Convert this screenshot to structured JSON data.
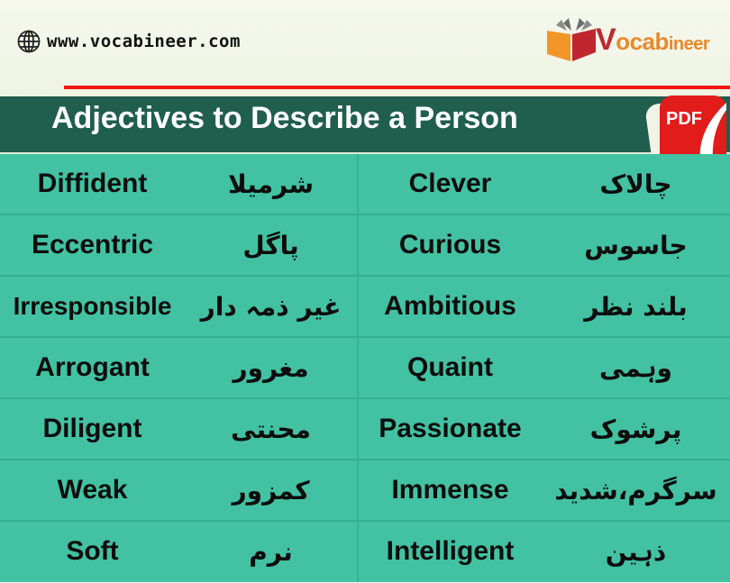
{
  "header": {
    "website": "www.vocabineer.com",
    "globe_icon": "globe-icon",
    "logo": {
      "initial": "V",
      "rest_a": "ocab",
      "rest_b": "ineer",
      "book_icon": "open-book-icon"
    },
    "accent_red": "#f21414"
  },
  "title": "Adjectives to Describe a Person",
  "pdf_badge": {
    "label": "PDF",
    "icon": "pdf-icon"
  },
  "colors": {
    "title_bg": "#205e4d",
    "table_bg": "#42c2a2"
  },
  "rows": [
    {
      "left_en": "Diffident",
      "left_ur": "شرمیلا",
      "right_en": "Clever",
      "right_ur": "چالاک"
    },
    {
      "left_en": "Eccentric",
      "left_ur": "پاگل",
      "right_en": "Curious",
      "right_ur": "جاسوس"
    },
    {
      "left_en": "Irresponsible",
      "left_ur": "غیر ذمہ دار",
      "right_en": "Ambitious",
      "right_ur": "بلند نظر"
    },
    {
      "left_en": "Arrogant",
      "left_ur": "مغرور",
      "right_en": "Quaint",
      "right_ur": "وہمی"
    },
    {
      "left_en": "Diligent",
      "left_ur": "محنتی",
      "right_en": "Passionate",
      "right_ur": "پرشوک"
    },
    {
      "left_en": "Weak",
      "left_ur": "کمزور",
      "right_en": "Immense",
      "right_ur": "سرگرم،شدید"
    },
    {
      "left_en": "Soft",
      "left_ur": "نرم",
      "right_en": "Intelligent",
      "right_ur": "ذہین"
    }
  ]
}
